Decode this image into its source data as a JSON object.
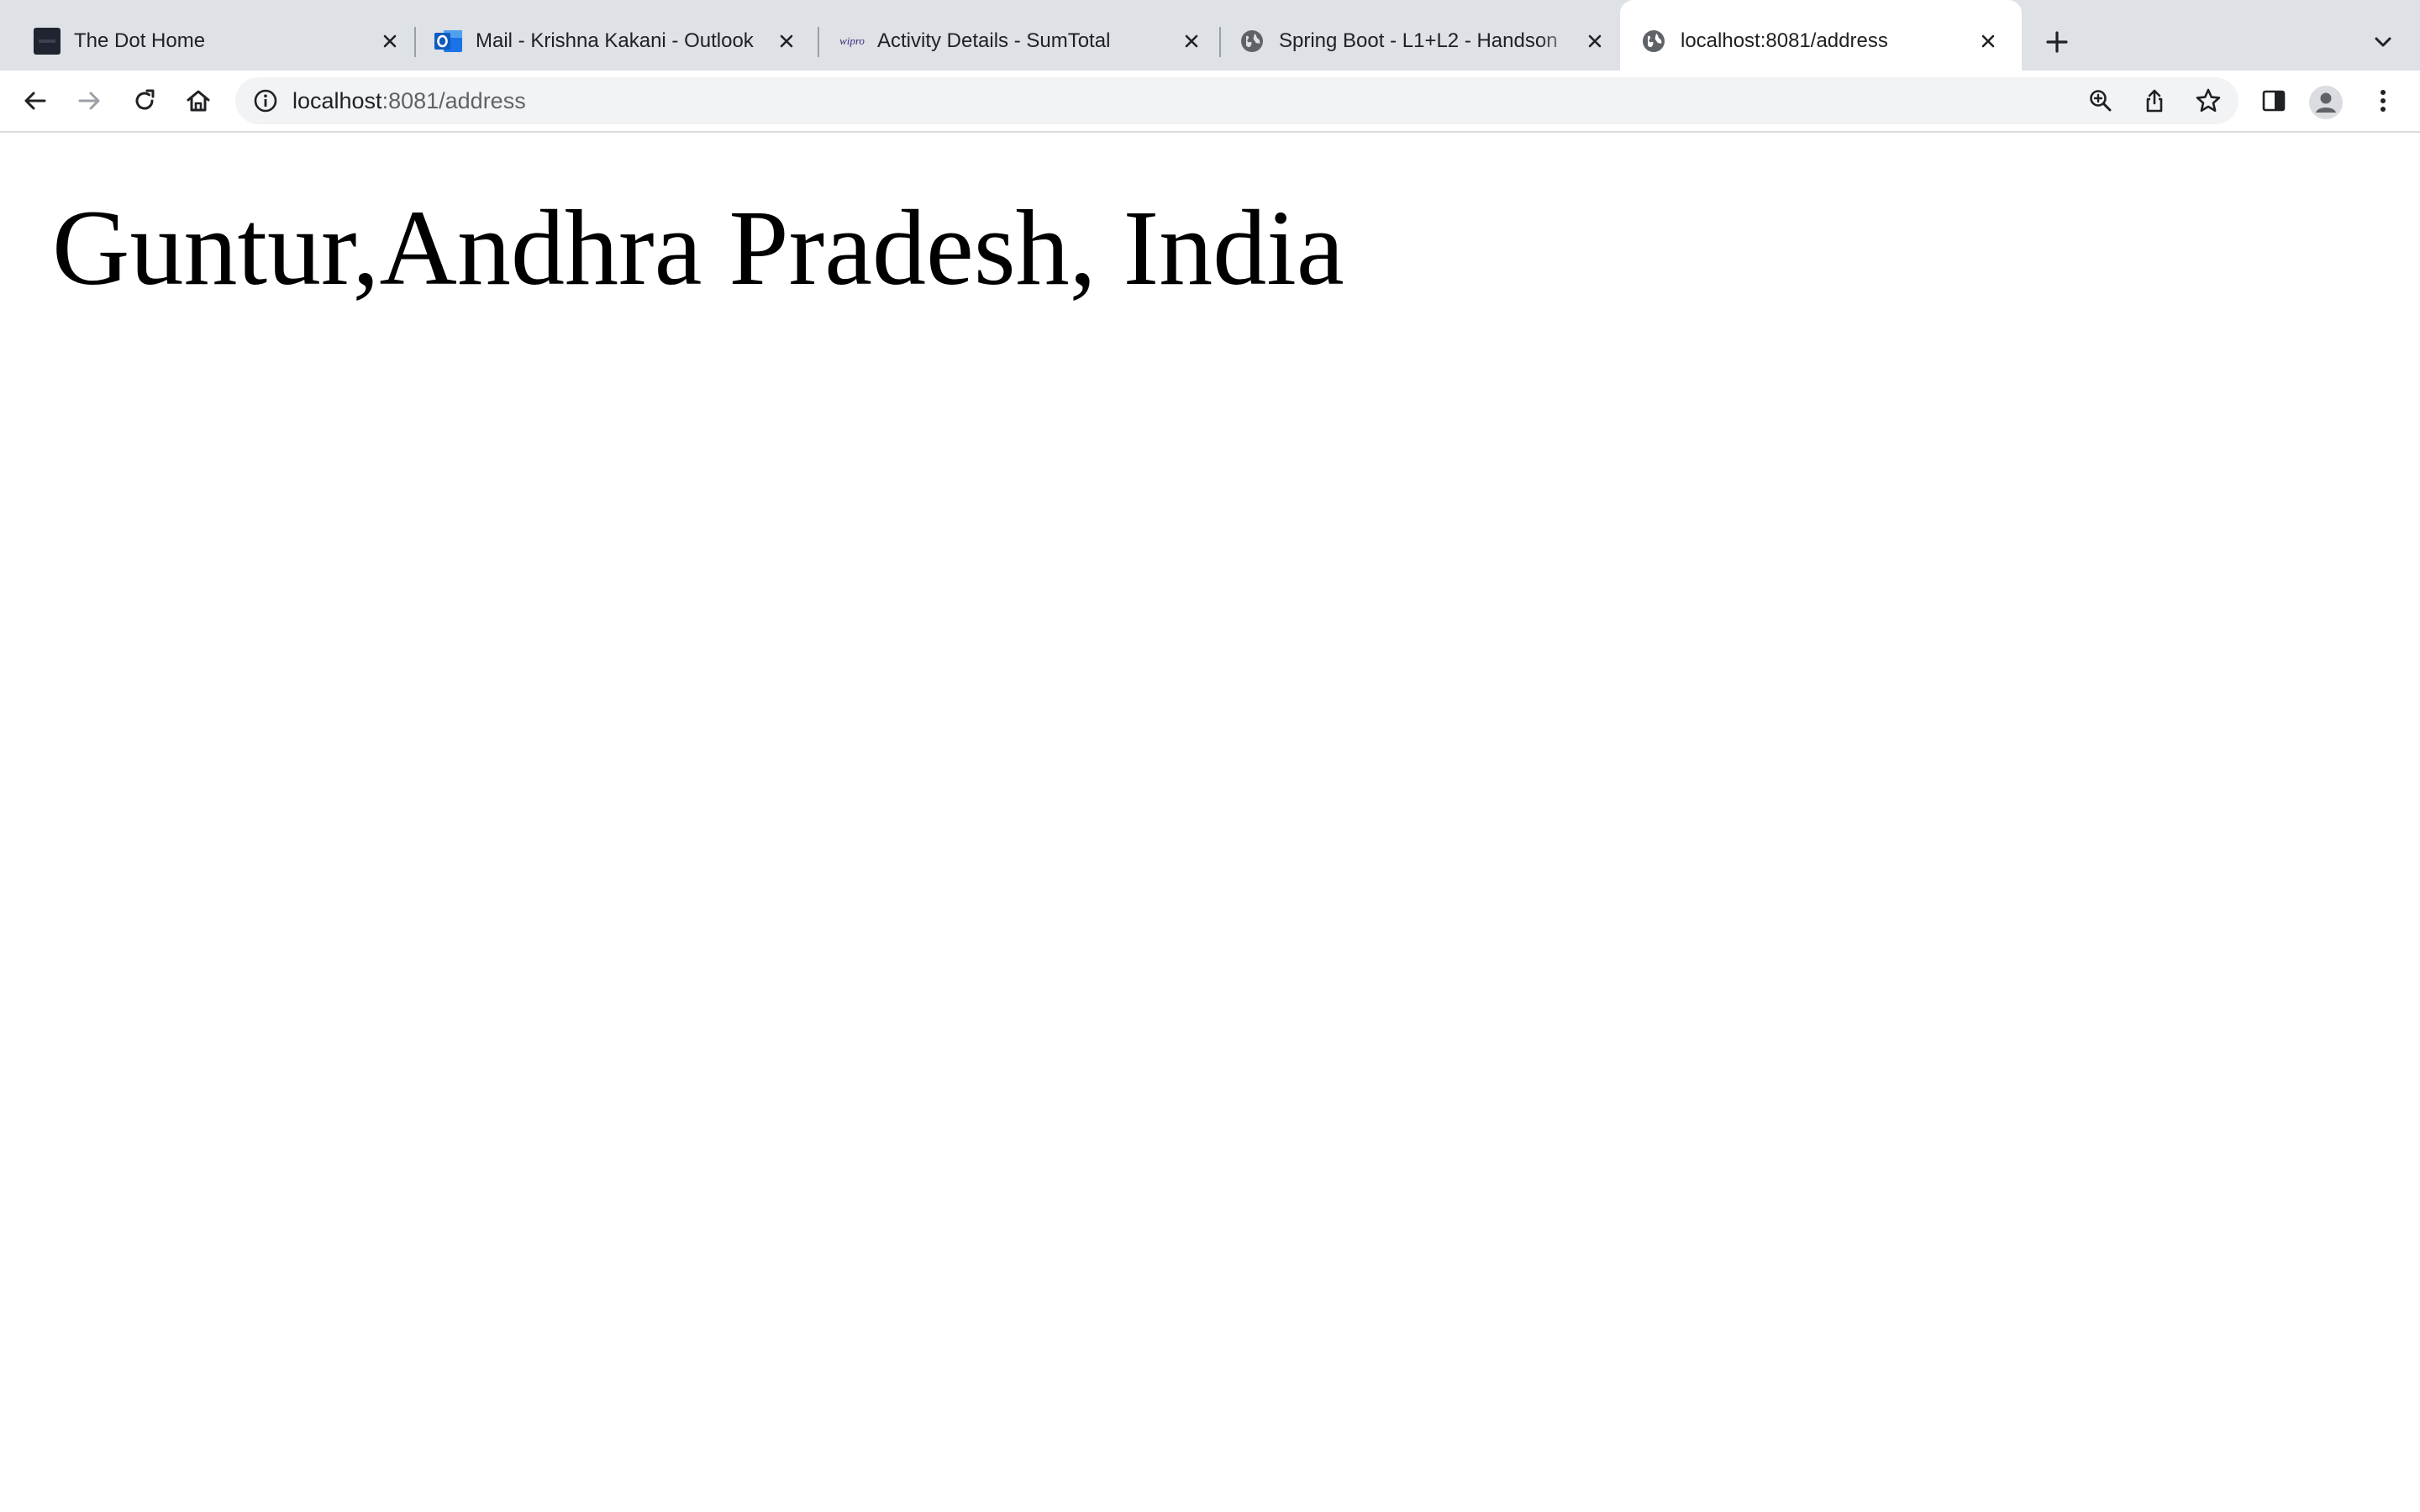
{
  "browser": {
    "tabs": [
      {
        "title": "The Dot Home",
        "favicon": "the-dot-favicon",
        "active": false
      },
      {
        "title": "Mail - Krishna Kakani - Outlook",
        "favicon": "outlook-favicon",
        "active": false
      },
      {
        "title": "Activity Details - SumTotal",
        "favicon": "wipro-favicon",
        "favicon_text": "wipro",
        "active": false
      },
      {
        "title": "Spring Boot - L1+L2 - Handson",
        "favicon": "globe-icon",
        "active": false
      },
      {
        "title": "localhost:8081/address",
        "favicon": "globe-icon",
        "active": true
      }
    ],
    "address_bar": {
      "host": "localhost",
      "rest": ":8081/address"
    },
    "colors": {
      "tabstrip": "#dee1e6",
      "toolbar": "#ffffff",
      "omnibox": "#f1f3f4",
      "icon": "#5f6368"
    }
  },
  "page": {
    "heading": "Guntur,Andhra Pradesh, India"
  }
}
